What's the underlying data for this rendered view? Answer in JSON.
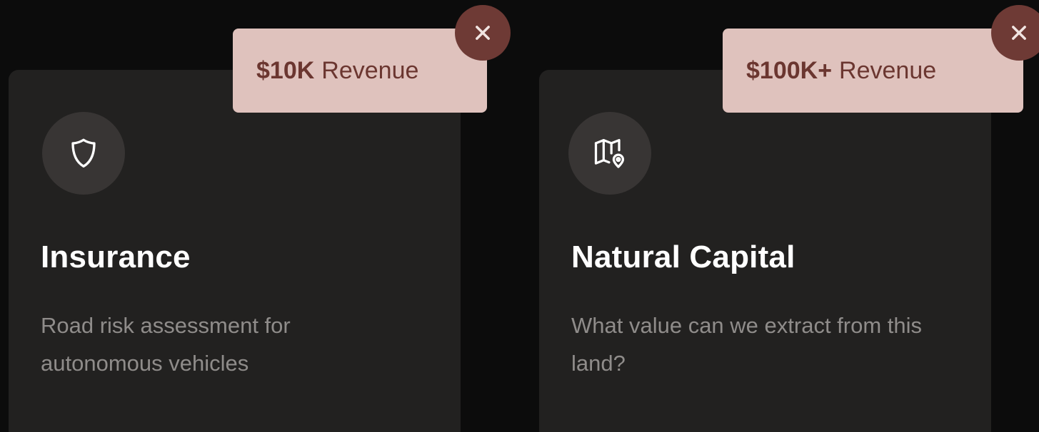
{
  "cards": [
    {
      "title": "Insurance",
      "description": "Road risk assessment for autonomous vehicles",
      "icon": "shield-icon",
      "badge": {
        "amount": "$10K",
        "label": "Revenue"
      }
    },
    {
      "title": "Natural Capital",
      "description": "What value can we extract from this land?",
      "icon": "map-pin-icon",
      "badge": {
        "amount": "$100K+",
        "label": "Revenue"
      }
    }
  ],
  "close_glyph": "✕",
  "colors": {
    "background": "#0c0c0c",
    "card": "#222120",
    "icon_circle": "#383534",
    "badge_bg": "#dfc2bd",
    "badge_text": "#6b3630",
    "close_bg": "#6e3a35",
    "description": "#8f8c8a"
  }
}
